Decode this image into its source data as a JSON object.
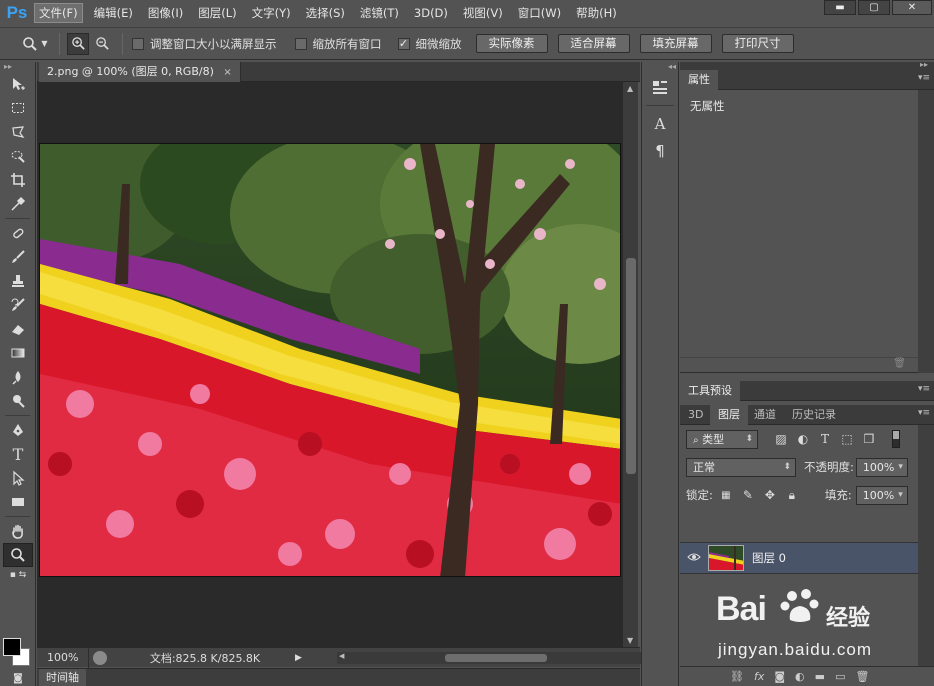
{
  "app": {
    "logo": "Ps"
  },
  "menu": [
    "文件(F)",
    "编辑(E)",
    "图像(I)",
    "图层(L)",
    "文字(Y)",
    "选择(S)",
    "滤镜(T)",
    "3D(D)",
    "视图(V)",
    "窗口(W)",
    "帮助(H)"
  ],
  "window_controls": {
    "minimize": "▬",
    "maximize": "▢",
    "close": "✕"
  },
  "options": {
    "resize_windows": "调整窗口大小以满屏显示",
    "zoom_all": "缩放所有窗口",
    "scrubby_zoom": "细微缩放",
    "scrubby_checked": true,
    "buttons": [
      "实际像素",
      "适合屏幕",
      "填充屏幕",
      "打印尺寸"
    ]
  },
  "document": {
    "tab_title": "2.png @ 100% (图层 0, RGB/8)",
    "close": "×"
  },
  "status": {
    "zoom": "100%",
    "doc_info": "文档:825.8 K/825.8K"
  },
  "timeline": {
    "label": "时间轴"
  },
  "properties": {
    "tab": "属性",
    "body": "无属性"
  },
  "tool_presets": {
    "tab": "工具预设"
  },
  "layers": {
    "tabs": [
      "3D",
      "图层",
      "通道",
      "历史记录"
    ],
    "filter_kind": "类型",
    "blend_mode": "正常",
    "opacity_label": "不透明度:",
    "opacity_value": "100%",
    "lock_label": "锁定:",
    "fill_label": "填充:",
    "fill_value": "100%",
    "layer_name": "图层 0"
  },
  "watermark": {
    "brand": "Bai",
    "brand_cn": "经验",
    "url": "jingyan.baidu.com"
  },
  "colors": {
    "menu_bg": "#535353",
    "canvas_bg": "#2a2a2a",
    "layer_selected": "#4a5468",
    "logo": "#3ba3f5"
  }
}
